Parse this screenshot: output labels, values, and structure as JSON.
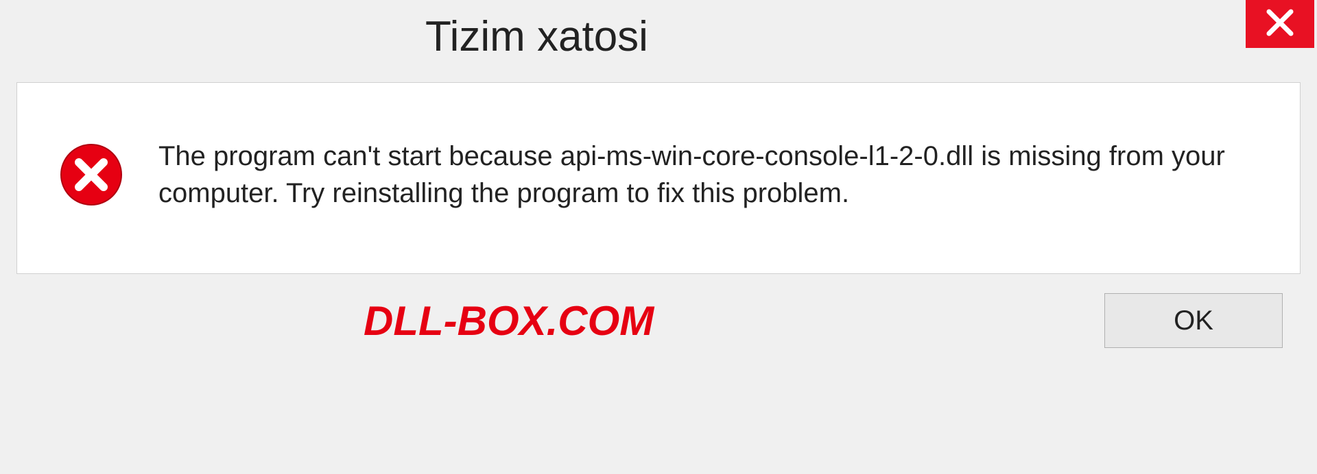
{
  "titlebar": {
    "title": "Tizim xatosi"
  },
  "body": {
    "message": "The program can't start because api-ms-win-core-console-l1-2-0.dll is missing from your computer. Try reinstalling the program to fix this problem."
  },
  "footer": {
    "watermark": "DLL-BOX.COM",
    "ok_label": "OK"
  },
  "icons": {
    "close": "close-icon",
    "error": "error-icon"
  },
  "colors": {
    "close_bg": "#e81123",
    "error_circle": "#e60012",
    "watermark": "#e60012"
  }
}
